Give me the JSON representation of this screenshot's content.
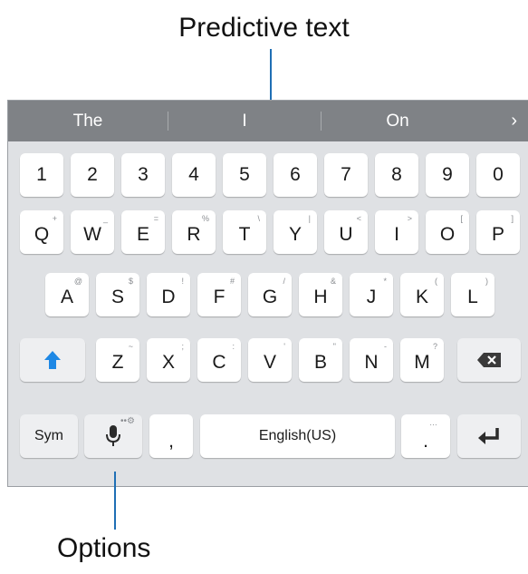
{
  "callouts": {
    "top": "Predictive text",
    "bottom": "Options"
  },
  "prediction_bar": {
    "suggestions": [
      "The",
      "I",
      "On"
    ],
    "more_icon": "chevron-right-icon"
  },
  "keyboard": {
    "number_row": [
      "1",
      "2",
      "3",
      "4",
      "5",
      "6",
      "7",
      "8",
      "9",
      "0"
    ],
    "row1": [
      {
        "key": "Q",
        "hint": "+"
      },
      {
        "key": "W",
        "hint": "_"
      },
      {
        "key": "E",
        "hint": "="
      },
      {
        "key": "R",
        "hint": "%"
      },
      {
        "key": "T",
        "hint": "\\"
      },
      {
        "key": "Y",
        "hint": "|"
      },
      {
        "key": "U",
        "hint": "<"
      },
      {
        "key": "I",
        "hint": ">"
      },
      {
        "key": "O",
        "hint": "["
      },
      {
        "key": "P",
        "hint": "]"
      }
    ],
    "row2": [
      {
        "key": "A",
        "hint": "@"
      },
      {
        "key": "S",
        "hint": "$"
      },
      {
        "key": "D",
        "hint": "!"
      },
      {
        "key": "F",
        "hint": "#"
      },
      {
        "key": "G",
        "hint": "/"
      },
      {
        "key": "H",
        "hint": "&"
      },
      {
        "key": "J",
        "hint": "*"
      },
      {
        "key": "K",
        "hint": "("
      },
      {
        "key": "L",
        "hint": ")"
      }
    ],
    "row3": [
      {
        "key": "Z",
        "hint": "~"
      },
      {
        "key": "X",
        "hint": ";"
      },
      {
        "key": "C",
        "hint": ":"
      },
      {
        "key": "V",
        "hint": "'"
      },
      {
        "key": "B",
        "hint": "\""
      },
      {
        "key": "N",
        "hint": "-"
      },
      {
        "key": "M",
        "hint": "?"
      }
    ],
    "shift_icon": "shift-arrow-icon",
    "backspace_icon": "backspace-icon",
    "sym_label": "Sym",
    "mic_icon": "microphone-icon",
    "comma_label": ",",
    "space_label": "English(US)",
    "period_label": ".",
    "enter_icon": "enter-icon",
    "accent_color": "#1e88e5"
  }
}
